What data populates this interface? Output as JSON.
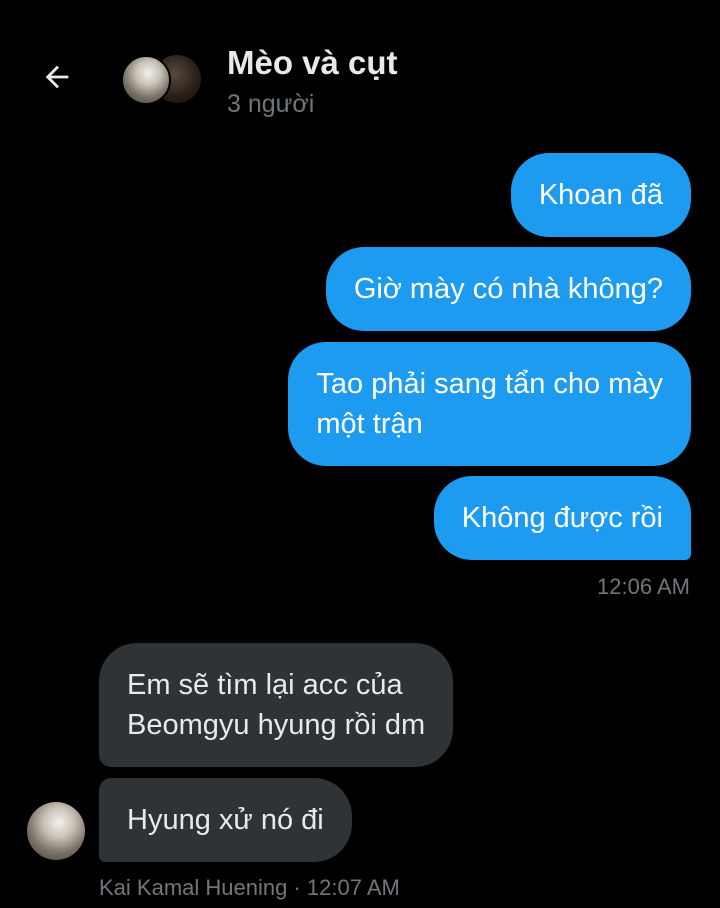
{
  "header": {
    "back_icon": "arrow-left-icon",
    "title": "Mèo và cụt",
    "subtitle": "3 người"
  },
  "colors": {
    "background": "#000000",
    "outgoing_bubble": "#1d9bf0",
    "incoming_bubble": "#2f3336",
    "secondary_text": "#71767b"
  },
  "messages": {
    "outgoing": [
      {
        "text": "Khoan đã"
      },
      {
        "text": "Giờ mày có nhà không?"
      },
      {
        "line1": "Tao phải sang tẩn cho mày",
        "line2": "một trận"
      },
      {
        "text": "Không được rồi"
      }
    ],
    "outgoing_time": "12:06 AM",
    "incoming": [
      {
        "line1": "Em sẽ tìm lại acc của",
        "line2": "Beomgyu hyung rồi dm"
      },
      {
        "text": "Hyung xử nó đi"
      }
    ],
    "incoming_meta": "Kai Kamal Huening · 12:07 AM"
  }
}
